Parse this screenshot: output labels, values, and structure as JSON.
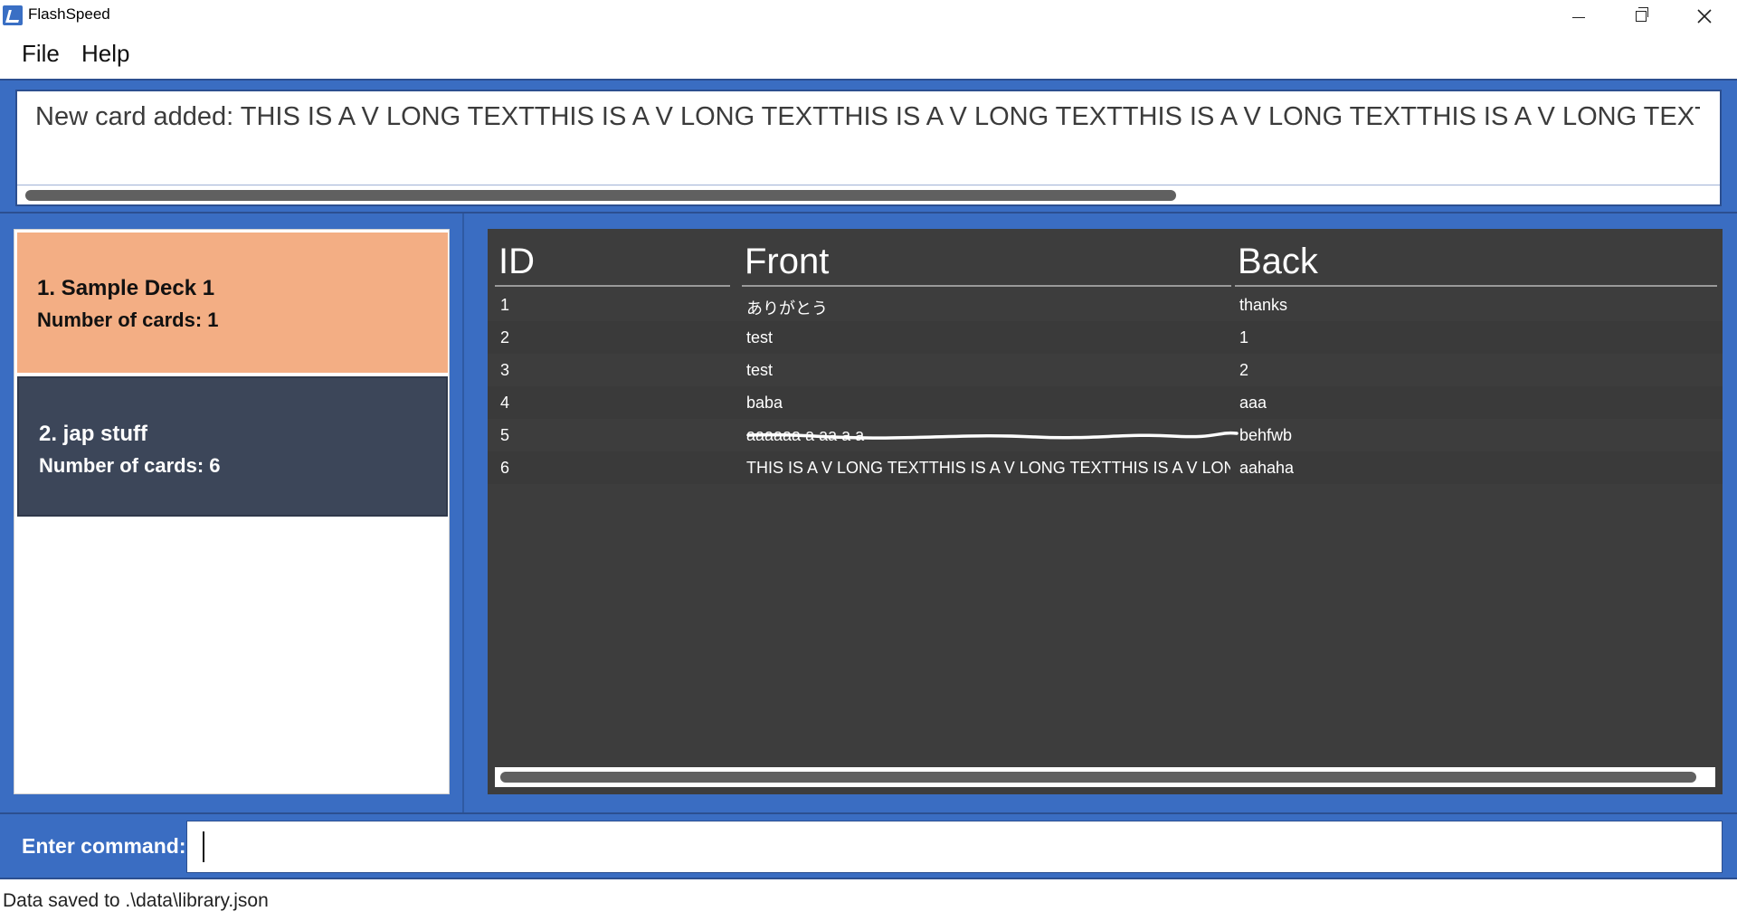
{
  "window": {
    "title": "FlashSpeed",
    "icon": "app-icon",
    "controls": [
      "minimize-icon",
      "restore-icon",
      "close-icon"
    ]
  },
  "menu": {
    "file": "File",
    "help": "Help"
  },
  "result": {
    "text": "New card added: THIS IS A V LONG TEXTTHIS IS A V LONG TEXTTHIS IS A V LONG TEXTTHIS IS A V LONG TEXTTHIS IS A V LONG TEXTTHIS IS A V"
  },
  "decks": [
    {
      "title": "1.  Sample Deck 1",
      "count": "Number of cards: 1",
      "selected": true
    },
    {
      "title": "2.  jap stuff",
      "count": "Number of cards: 6",
      "selected": false
    }
  ],
  "table": {
    "headers": {
      "id": "ID",
      "front": "Front",
      "back": "Back"
    },
    "rows": [
      {
        "id": "1",
        "front": "ありがとう",
        "back": "thanks"
      },
      {
        "id": "2",
        "front": "test",
        "back": "1"
      },
      {
        "id": "3",
        "front": "test",
        "back": "2"
      },
      {
        "id": "4",
        "front": "baba",
        "back": "aaa"
      },
      {
        "id": "5",
        "front": "aaaaaa a aa a a",
        "back": "behfwb"
      },
      {
        "id": "6",
        "front": "THIS IS A V LONG TEXTTHIS IS A V LONG TEXTTHIS IS A V LONG ...",
        "back": "aahaha"
      }
    ]
  },
  "command": {
    "label": "Enter command:",
    "value": ""
  },
  "status": {
    "text": "Data saved to .\\data\\library.json"
  },
  "colors": {
    "accent": "#3a6dc2",
    "selected_deck": "#f3ae84",
    "unselected_deck": "#3c4659",
    "table_bg": "#3d3d3d"
  }
}
